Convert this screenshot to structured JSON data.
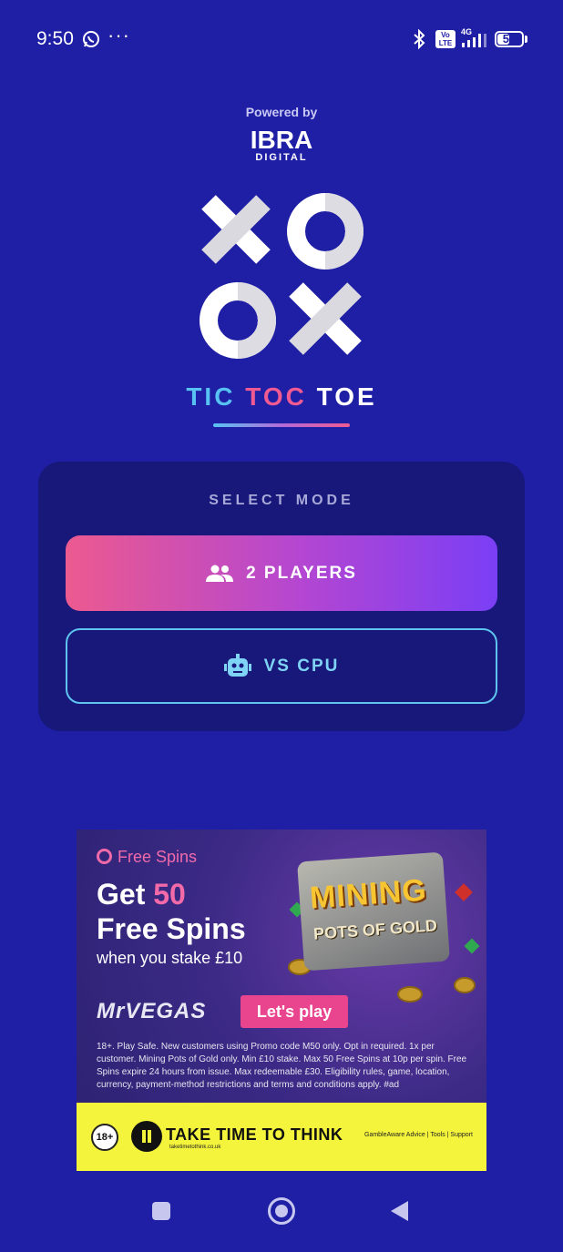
{
  "status_bar": {
    "time": "9:50",
    "more": "···",
    "volte": "Vo LTE",
    "network": "4G",
    "battery_level": 55
  },
  "header": {
    "powered_by": "Powered by",
    "brand_main": "IBRA",
    "brand_sub": "DIGITAL",
    "title_parts": [
      "TIC",
      "TOC",
      "TOE"
    ],
    "title_colors": [
      "#58c3f3",
      "#ef5a92",
      "#ffffff"
    ]
  },
  "mode_card": {
    "heading": "SELECT MODE",
    "two_players_label": "2 PLAYERS",
    "vs_cpu_label": "VS CPU"
  },
  "ad": {
    "tag": "Free Spins",
    "headline_pre": "Get ",
    "headline_num": "50",
    "headline_line2": "Free Spins",
    "subline": "when you stake £10",
    "brand": "MrVEGAS",
    "cta": "Let's play",
    "game_name_1": "MINING",
    "game_name_2": "POTS OF GOLD",
    "terms": "18+. Play Safe. New customers using Promo code M50 only. Opt in required. 1x per customer. Mining Pots of Gold only. Min £10 stake. Max 50 Free Spins at 10p per spin. Free Spins expire 24 hours from issue. Max redeemable £30. Eligibility rules, game, location, currency, payment-method restrictions and terms and conditions apply. #ad",
    "age": "18+",
    "take_time": "TAKE TIME TO THINK",
    "take_time_url": "taketimetothink.co.uk",
    "gamble_aware": "GambleAware  Advice | Tools | Support"
  },
  "colors": {
    "background": "#1f1fa6",
    "card": "#17187a",
    "accent_pink": "#ec5a8f",
    "accent_purple": "#7a3ff5",
    "accent_cyan": "#5ec4ee"
  },
  "icons": {
    "two_players": "group-icon",
    "vs_cpu": "robot-icon",
    "nav": [
      "recents-square-icon",
      "home-circle-icon",
      "back-triangle-icon"
    ]
  }
}
